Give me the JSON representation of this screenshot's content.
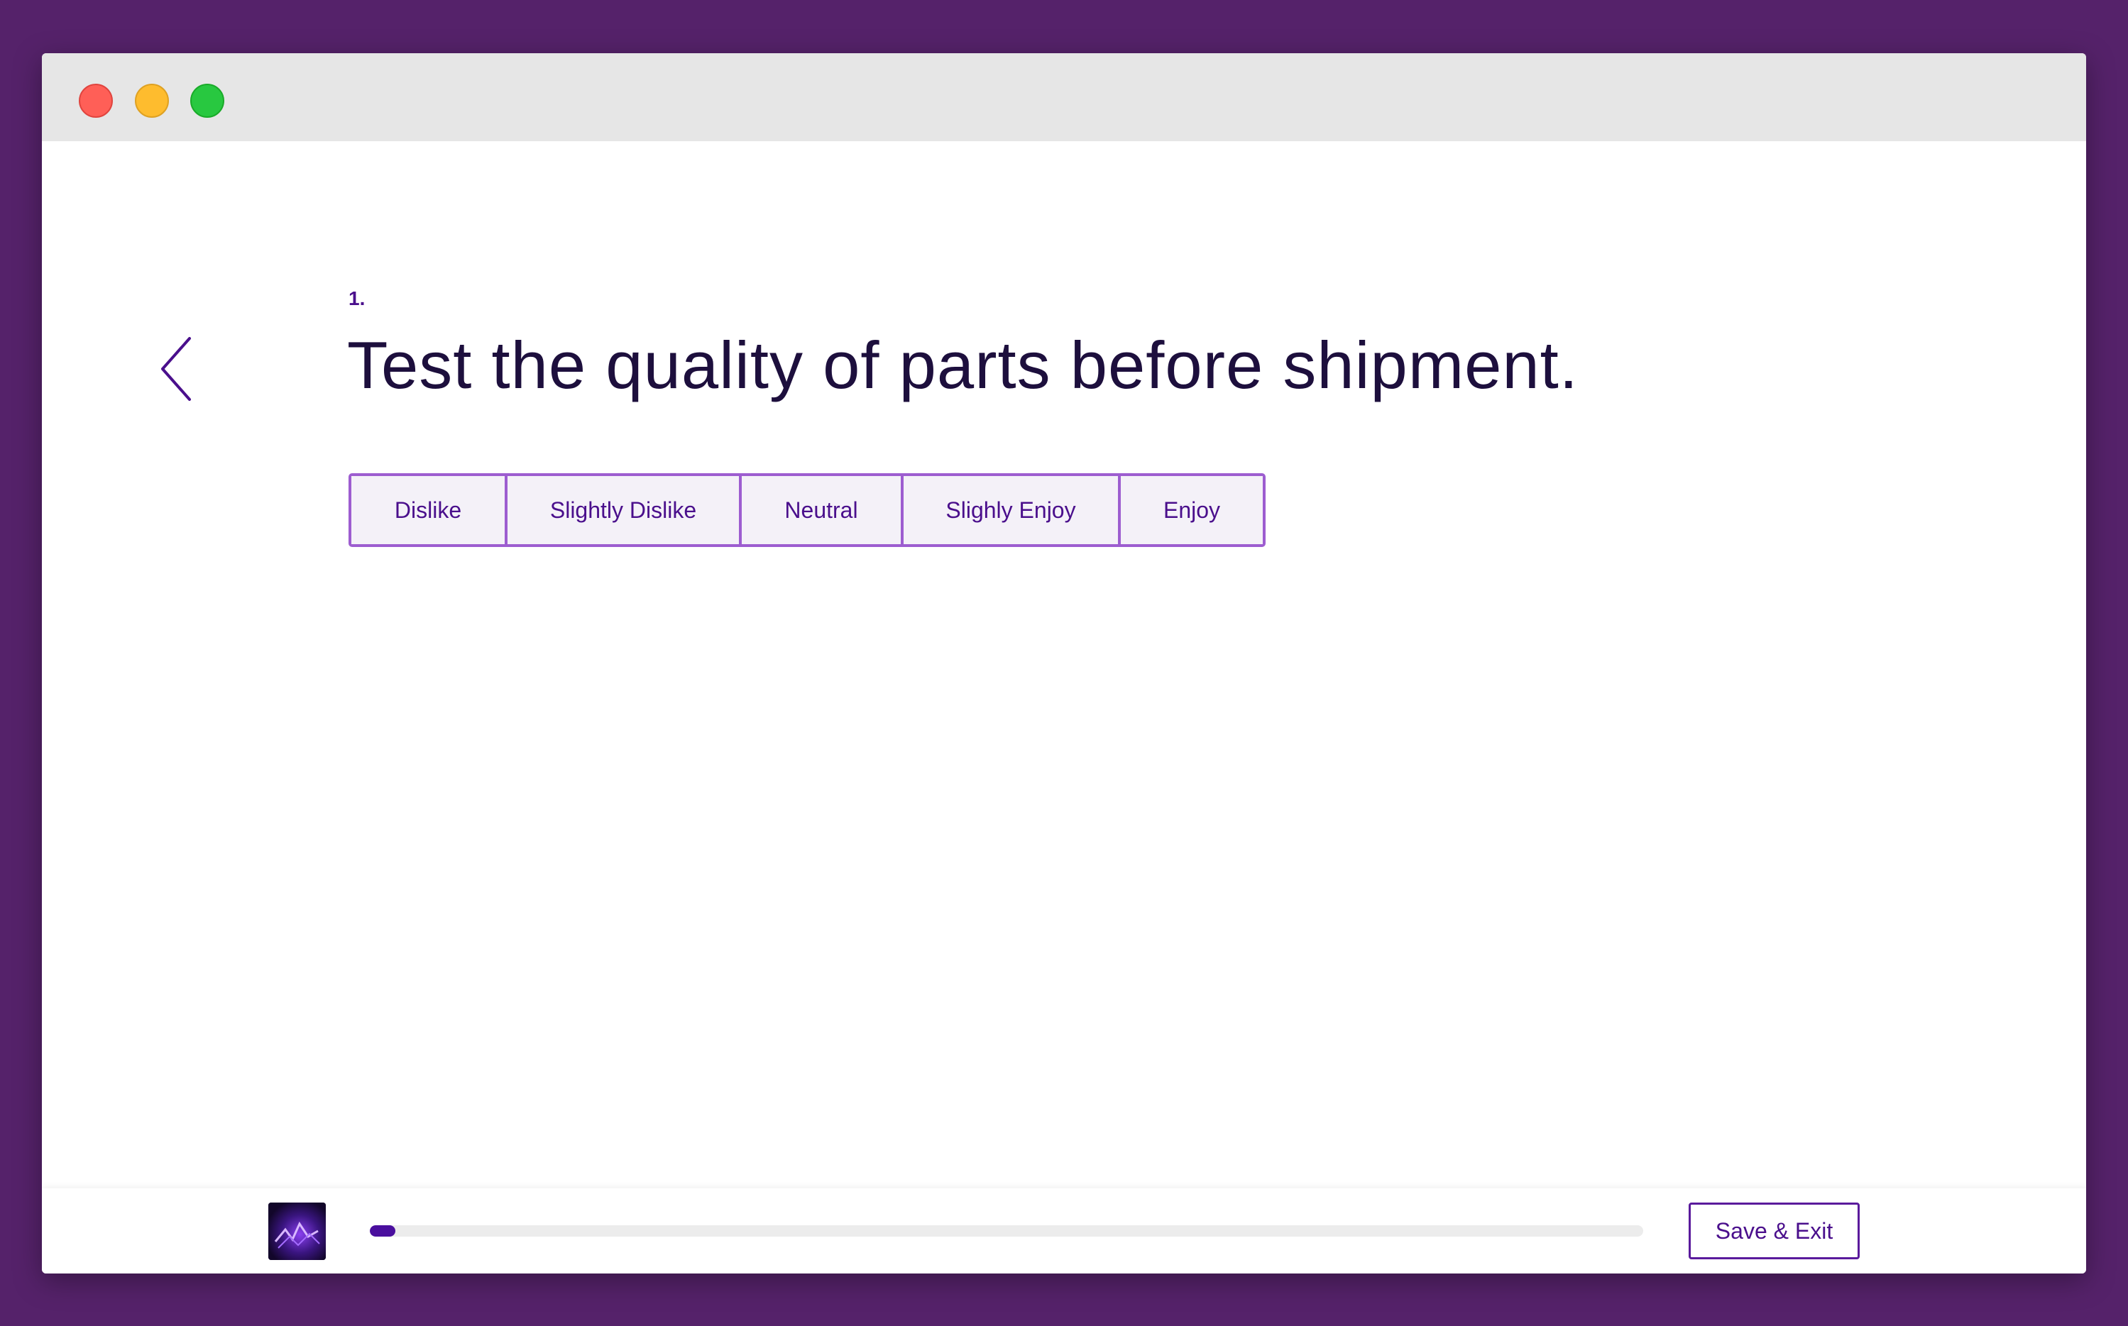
{
  "window": {
    "controls": [
      "close",
      "minimize",
      "maximize"
    ]
  },
  "question": {
    "number": "1.",
    "text": "Test the quality of parts before shipment."
  },
  "options": [
    {
      "label": "Dislike"
    },
    {
      "label": "Slightly Dislike"
    },
    {
      "label": "Neutral"
    },
    {
      "label": "Slighly Enjoy"
    },
    {
      "label": "Enjoy"
    }
  ],
  "footer": {
    "progress_fraction": 0.02,
    "save_exit_label": "Save & Exit"
  },
  "colors": {
    "background": "#55226a",
    "accent": "#4a0f8c",
    "option_border": "#9d5dd0",
    "option_bg": "#f4f1f8",
    "question_text": "#1d0f3d"
  },
  "icons": {
    "back": "chevron-left-icon"
  }
}
